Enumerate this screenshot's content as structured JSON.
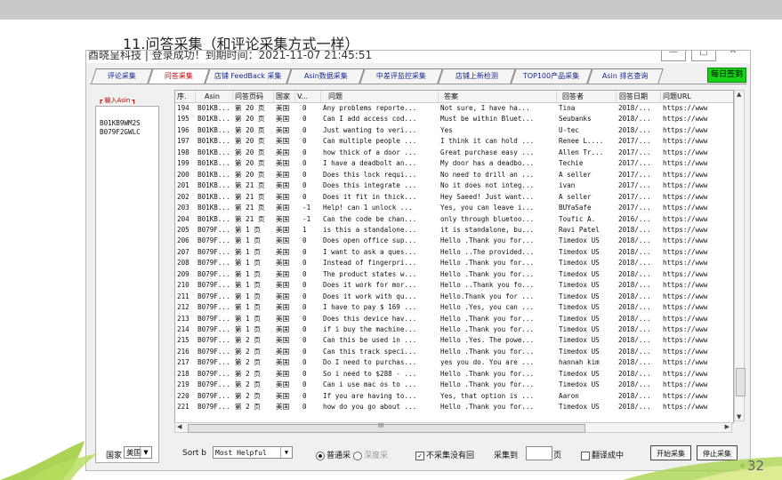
{
  "slide": {
    "title": "11.问答采集（和评论采集方式一样）",
    "page_number": "32"
  },
  "window": {
    "title": "酉晓呈科技 | 登录成功！到期时间：2021-11-07 21:45:51"
  },
  "tabs": [
    {
      "label": "评论采集",
      "active": false
    },
    {
      "label": "问答采集",
      "active": true
    },
    {
      "label": "店铺 FeedBack 采集",
      "active": false
    },
    {
      "label": "Asin数据采集",
      "active": false
    },
    {
      "label": "中差评监控采集",
      "active": false
    },
    {
      "label": "店铺上新检测",
      "active": false
    },
    {
      "label": "TOP100产品采集",
      "active": false
    },
    {
      "label": "Asin 排名查询",
      "active": false
    }
  ],
  "signin_label": "每日签到",
  "input_label": "┏ 输入Asin ┓",
  "asins": [
    "B01KB9WM2S",
    "B079F2GWLC"
  ],
  "columns": [
    "序.",
    "Asin",
    "问答页码",
    "国家",
    "V...",
    "问题",
    "答案",
    "回答者",
    "回答日期",
    "问题URL"
  ],
  "rows": [
    [
      "194",
      "B01KB...",
      "第 20 页",
      "美国",
      "0",
      "Any problems reporte...",
      "Not sure,  I have ha...",
      "Tina",
      "2018/...",
      "https://www"
    ],
    [
      "195",
      "B01KB...",
      "第 20 页",
      "美国",
      "0",
      "Can I add access cod...",
      "Must be within Bluet...",
      "Seubanks",
      "2018/...",
      "https://www"
    ],
    [
      "196",
      "B01KB...",
      "第 20 页",
      "美国",
      "0",
      "Just wanting to veri...",
      "Yes",
      "U-tec",
      "2018/...",
      "https://www"
    ],
    [
      "197",
      "B01KB...",
      "第 20 页",
      "美国",
      "0",
      "Can multiple people ...",
      "I think it can hold ...",
      "Renee L....",
      "2017/...",
      "https://www"
    ],
    [
      "198",
      "B01KB...",
      "第 20 页",
      "美国",
      "0",
      "how thick of a door ...",
      "Great purchase easy ...",
      "Allen Tr...",
      "2017/...",
      "https://www"
    ],
    [
      "199",
      "B01KB...",
      "第 20 页",
      "美国",
      "0",
      "I have a deadbolt an...",
      "My door has a deadbo...",
      "Techie",
      "2017/...",
      "https://www"
    ],
    [
      "200",
      "B01KB...",
      "第 20 页",
      "美国",
      "0",
      "Does this lock requi...",
      "No need to drill an ...",
      "A seller",
      "2017/...",
      "https://www"
    ],
    [
      "201",
      "B01KB...",
      "第 21 页",
      "美国",
      "0",
      "Does this integrate ...",
      "No it does not integ...",
      "ivan",
      "2017/...",
      "https://www"
    ],
    [
      "202",
      "B01KB...",
      "第 21 页",
      "美国",
      "0",
      "Does it fit in thick...",
      "Hey Saeed! Just want...",
      "A seller",
      "2017/...",
      "https://www"
    ],
    [
      "203",
      "B01KB...",
      "第 21 页",
      "美国",
      "-1",
      "Help!  can 1 unlock ...",
      "Yes, you can leave i...",
      "BUYaSafe",
      "2017/...",
      "https://www"
    ],
    [
      "204",
      "B01KB...",
      "第 21 页",
      "美国",
      "-1",
      "Can the code be chan...",
      "only through bluetoo...",
      "Toufic A.",
      "2016/...",
      "https://www"
    ],
    [
      "205",
      "B079F...",
      "第 1 页",
      "美国",
      "1",
      "is this a standalone...",
      "it is standalone, bu...",
      "Ravi Patel",
      "2018/...",
      "https://www"
    ],
    [
      "206",
      "B079F...",
      "第 1 页",
      "美国",
      "0",
      "Does open office sup...",
      "Hello .Thank you for...",
      "Timedox US",
      "2018/...",
      "https://www"
    ],
    [
      "207",
      "B079F...",
      "第 1 页",
      "美国",
      "0",
      "I want to ask a ques...",
      "Hello ..The provided...",
      "Timedox US",
      "2018/...",
      "https://www"
    ],
    [
      "208",
      "B079F...",
      "第 1 页",
      "美国",
      "0",
      "Instead of fingerpri...",
      "Hello .Thank you for...",
      "Timedox US",
      "2018/...",
      "https://www"
    ],
    [
      "209",
      "B079F...",
      "第 1 页",
      "美国",
      "0",
      "The product states w...",
      "Hello .Thank you for...",
      "Timedox US",
      "2018/...",
      "https://www"
    ],
    [
      "210",
      "B079F...",
      "第 1 页",
      "美国",
      "0",
      "Does it work for mor...",
      "Hello ..Thank you fo...",
      "Timedox US",
      "2018/...",
      "https://www"
    ],
    [
      "211",
      "B079F...",
      "第 1 页",
      "美国",
      "0",
      "Does it work with qu...",
      "Hello.Thank you for ...",
      "Timedox US",
      "2018/...",
      "https://www"
    ],
    [
      "212",
      "B079F...",
      "第 1 页",
      "美国",
      "0",
      "I have to pay $ 169 ...",
      "Hello .Yes, you can ...",
      "Timedox US",
      "2018/...",
      "https://www"
    ],
    [
      "213",
      "B079F...",
      "第 1 页",
      "美国",
      "0",
      "Does this device hav...",
      "Hello .Thank you for...",
      "Timedox US",
      "2018/...",
      "https://www"
    ],
    [
      "214",
      "B079F...",
      "第 1 页",
      "美国",
      "0",
      "if i buy the machine...",
      "Hello .Thank you for...",
      "Timedox US",
      "2018/...",
      "https://www"
    ],
    [
      "215",
      "B079F...",
      "第 2 页",
      "美国",
      "0",
      "Can this be used in ...",
      "Hello .Yes. The powe...",
      "Timedox US",
      "2018/...",
      "https://www"
    ],
    [
      "216",
      "B079F...",
      "第 2 页",
      "美国",
      "0",
      "Can this track speci...",
      "Hello .Thank you for...",
      "Timedox US",
      "2018/...",
      "https://www"
    ],
    [
      "217",
      "B079F...",
      "第 2 页",
      "美国",
      "0",
      "Do I need to purchas...",
      "yes you do. You are ...",
      "hannah kim",
      "2018/...",
      "https://www"
    ],
    [
      "218",
      "B079F...",
      "第 2 页",
      "美国",
      "0",
      "So i need to $288 - ...",
      "Hello .Thank you for...",
      "Timedox US",
      "2018/...",
      "https://www"
    ],
    [
      "219",
      "B079F...",
      "第 2 页",
      "美国",
      "0",
      "Can i use mac os to ...",
      "Hello .Thank you for...",
      "Timedox US",
      "2018/...",
      "https://www"
    ],
    [
      "220",
      "B079F...",
      "第 2 页",
      "美国",
      "0",
      "If you are having to...",
      "Yes, that option is ...",
      "Aaron",
      "2018/...",
      "https://www"
    ],
    [
      "221",
      "B079F...",
      "第 2 页",
      "美国",
      "0",
      "how do you go about ...",
      "Hello .Thank you for...",
      "Timedox US",
      "2018/...",
      "https://www"
    ]
  ],
  "hscroll_label": "III",
  "bottom": {
    "country_label": "国家",
    "country_value": "美国",
    "sort_label": "Sort b",
    "sort_value": "Most Helpful",
    "radio_normal": "普通采",
    "radio_deep": "深度采",
    "checkbox_label": "不采集没有回",
    "collect_to_label": "采集到",
    "page_suffix": "页",
    "translate_label": "翻译成中",
    "start_button": "开始采集",
    "stop_button": "停止采集"
  }
}
